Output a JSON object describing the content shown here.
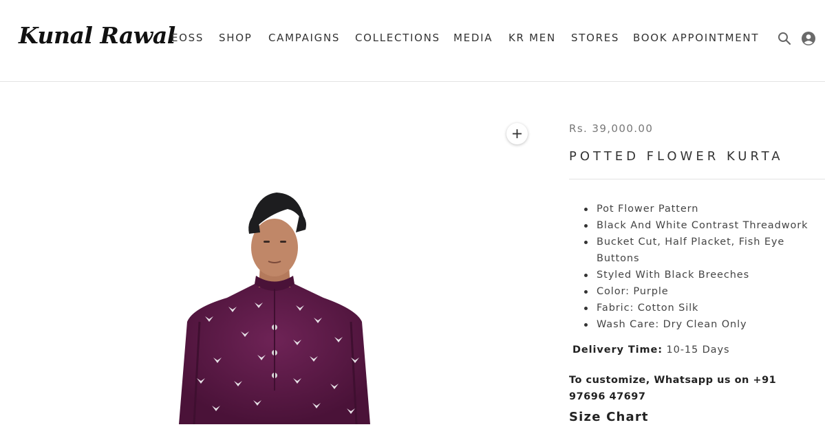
{
  "header": {
    "logo_text": "Kunal Rawal",
    "nav": [
      "EOSS",
      "SHOP",
      "CAMPAIGNS",
      "COLLECTIONS",
      "MEDIA",
      "KR MEN",
      "STORES",
      "BOOK APPOINTMENT"
    ],
    "icons": [
      "search-icon",
      "account-icon"
    ]
  },
  "product": {
    "price": "Rs. 39,000.00",
    "title": "POTTED FLOWER KURTA",
    "features": [
      "Pot Flower Pattern",
      "Black And White Contrast Threadwork",
      "Bucket Cut, Half Placket, Fish Eye Buttons",
      "Styled With Black Breeches",
      "Color: Purple",
      "Fabric: Cotton Silk",
      "Wash Care: Dry Clean Only"
    ],
    "delivery_label": "Delivery Time:",
    "delivery_value": "10-15 Days",
    "customize_text": "To customize, Whatsapp us on +91 97696 47697",
    "size_chart_label": "Size Chart",
    "colors": {
      "kurta": "#5b1a45",
      "kurta_shadow": "#3f0f30"
    }
  }
}
